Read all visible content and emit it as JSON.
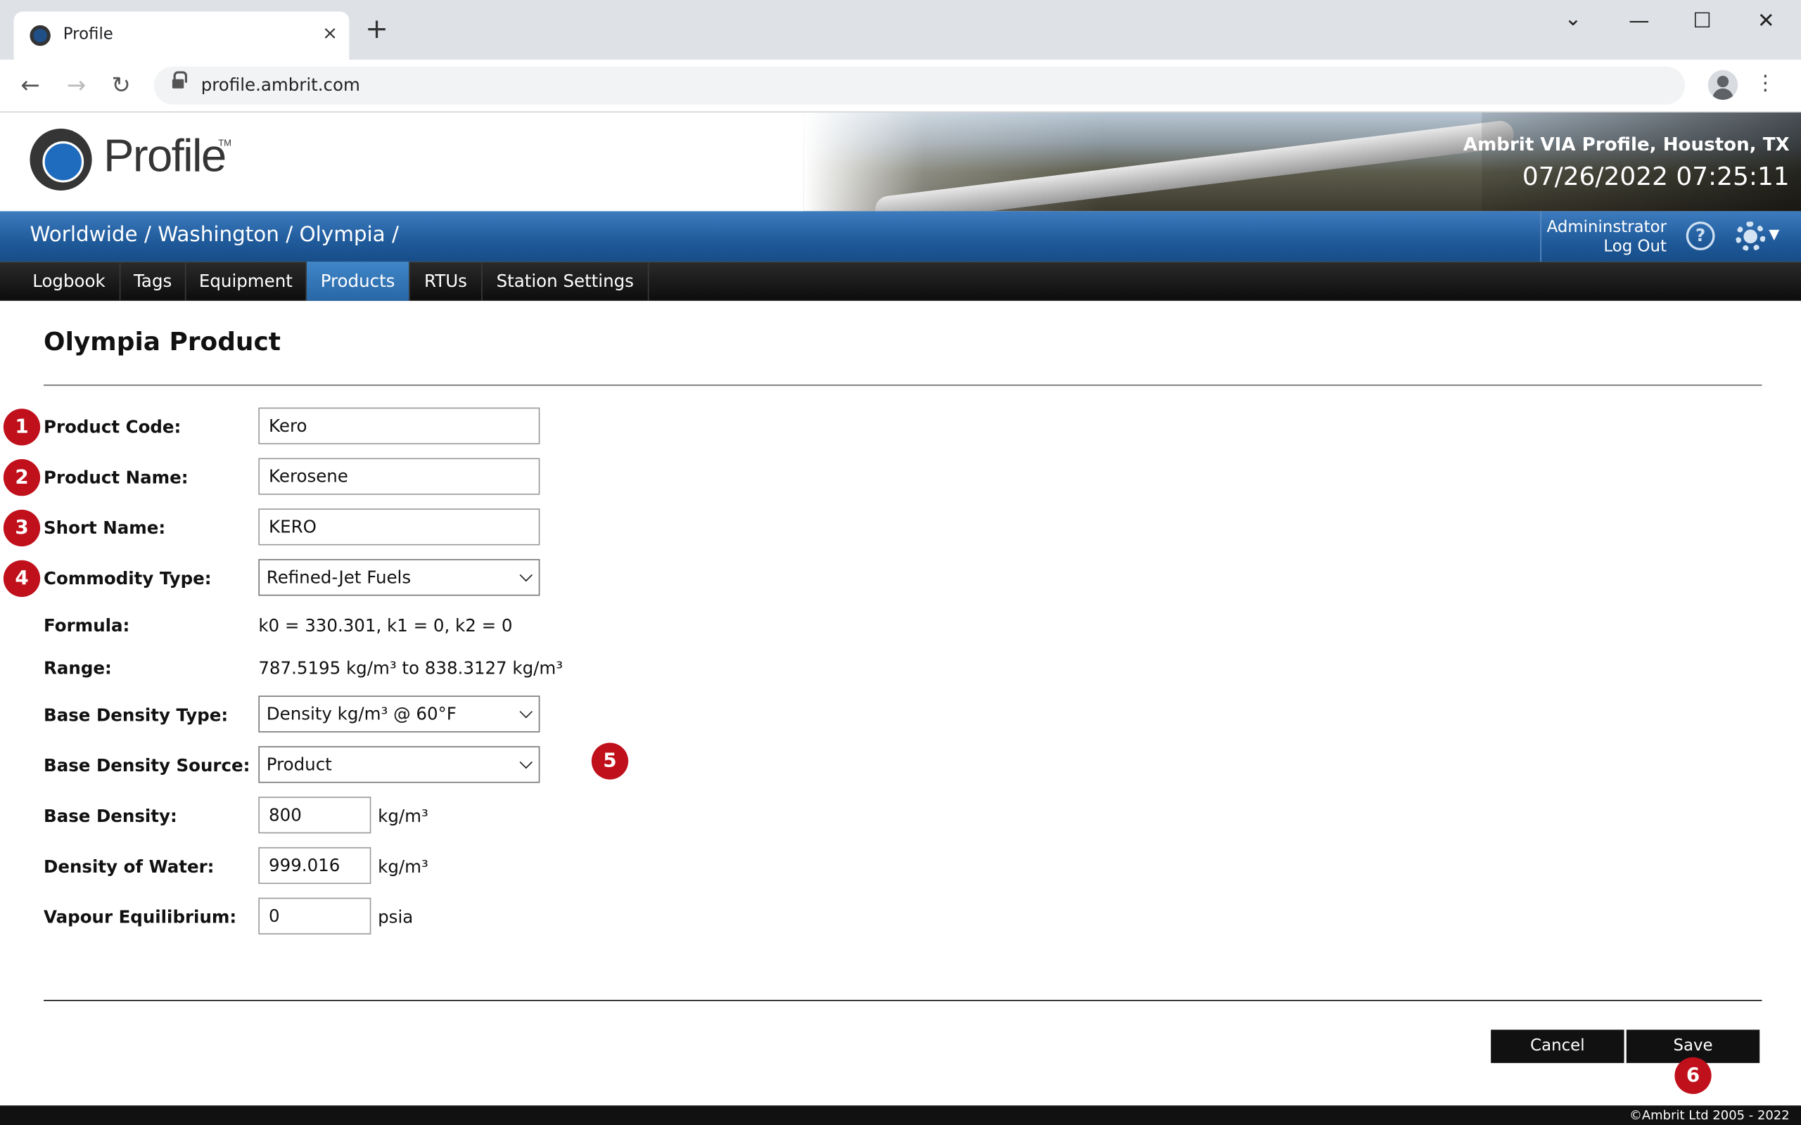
{
  "browser": {
    "tab_title": "Profile",
    "tab_close": "×",
    "new_tab": "+",
    "url": "profile.ambrit.com",
    "win_minimize": "—",
    "win_maximize": "☐",
    "win_close": "✕",
    "win_tabsearch": "⌄"
  },
  "header": {
    "logo_text": "Profile",
    "logo_tm": "TM",
    "site_name": "Ambrit VIA Profile, Houston, TX",
    "clock": "07/26/2022 07:25:11"
  },
  "breadcrumb": {
    "items": [
      "Worldwide",
      "Washington",
      "Olympia"
    ],
    "separator": " / "
  },
  "user": {
    "name": "Admininstrator",
    "logout": "Log Out",
    "help": "?"
  },
  "nav": {
    "tabs": [
      {
        "label": "Logbook",
        "active": false
      },
      {
        "label": "Tags",
        "active": false
      },
      {
        "label": "Equipment",
        "active": false
      },
      {
        "label": "Products",
        "active": true
      },
      {
        "label": "RTUs",
        "active": false
      },
      {
        "label": "Station Settings",
        "active": false
      }
    ]
  },
  "form": {
    "title": "Olympia Product",
    "product_code": {
      "label": "Product Code:",
      "value": "Kero"
    },
    "product_name": {
      "label": "Product Name:",
      "value": "Kerosene"
    },
    "short_name": {
      "label": "Short Name:",
      "value": "KERO"
    },
    "commodity_type": {
      "label": "Commodity Type:",
      "value": "Refined-Jet Fuels"
    },
    "formula": {
      "label": "Formula:",
      "value": "k0 = 330.301, k1 = 0, k2 = 0"
    },
    "range": {
      "label": "Range:",
      "value": "787.5195 kg/m³ to 838.3127 kg/m³"
    },
    "base_density_type": {
      "label": "Base Density Type:",
      "value": "Density kg/m³ @ 60°F"
    },
    "base_density_source": {
      "label": "Base Density Source:",
      "value": "Product"
    },
    "base_density": {
      "label": "Base Density:",
      "value": "800",
      "unit": "kg/m³"
    },
    "density_of_water": {
      "label": "Density of Water:",
      "value": "999.016",
      "unit": "kg/m³"
    },
    "vapour_equilibrium": {
      "label": "Vapour Equilibrium:",
      "value": "0",
      "unit": "psia"
    }
  },
  "buttons": {
    "cancel": "Cancel",
    "save": "Save"
  },
  "markers": [
    "1",
    "2",
    "3",
    "4",
    "5",
    "6"
  ],
  "footer": "©Ambrit Ltd 2005 - 2022",
  "colors": {
    "accent": "#2867a6",
    "marker": "#c0101c"
  }
}
